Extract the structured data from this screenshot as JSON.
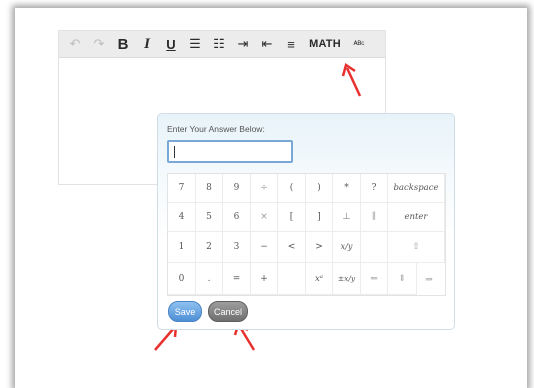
{
  "toolbar": {
    "buttons": [
      {
        "icon": "undo-icon",
        "glyph": "↶",
        "disabled": true
      },
      {
        "icon": "redo-icon",
        "glyph": "↷",
        "disabled": true
      },
      {
        "icon": "bold-icon",
        "glyph": "B"
      },
      {
        "icon": "italic-icon",
        "glyph": "I"
      },
      {
        "icon": "underline-icon",
        "glyph": "U"
      },
      {
        "icon": "bulleted-list-icon",
        "glyph": "☰"
      },
      {
        "icon": "numbered-list-icon",
        "glyph": "☷"
      },
      {
        "icon": "indent-icon",
        "glyph": "⇥"
      },
      {
        "icon": "outdent-icon",
        "glyph": "⇤"
      },
      {
        "icon": "align-icon",
        "glyph": "≡"
      },
      {
        "icon": "math-button",
        "glyph": "MATH"
      },
      {
        "icon": "spellcheck-icon",
        "glyph": "ᴬᴮᶜ"
      }
    ]
  },
  "dialog": {
    "label": "Enter Your Answer Below:",
    "input_value": "",
    "keypad": [
      [
        "7",
        "8",
        "9",
        "÷",
        "(",
        ")",
        "*",
        "?",
        "backspace"
      ],
      [
        "4",
        "5",
        "6",
        "×",
        "[",
        "]",
        "⊥",
        "∥",
        "enter"
      ],
      [
        "1",
        "2",
        "3",
        "−",
        "<",
        ">",
        "x/y",
        "",
        "⇧"
      ],
      [
        "0",
        ".",
        "=",
        "+",
        "",
        "xᵃ",
        "±x/y",
        "⇐",
        "⇕",
        "⇒"
      ]
    ],
    "save_label": "Save",
    "cancel_label": "Cancel"
  },
  "accent": {
    "arrow": "#e8312f",
    "save": "#4d8fd6",
    "cancel": "#6f6f6f"
  }
}
